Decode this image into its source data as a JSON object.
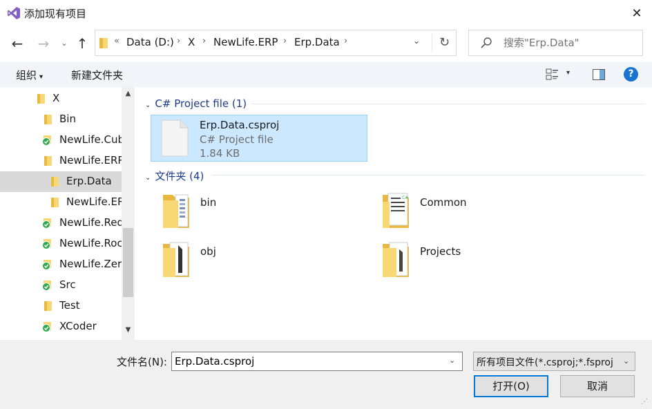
{
  "window": {
    "title": "添加现有项目",
    "close_glyph": "✕"
  },
  "nav": {
    "back_glyph": "←",
    "forward_glyph": "→",
    "recent_glyph": "⌄",
    "up_glyph": "↑",
    "refresh_glyph": "↻"
  },
  "address": {
    "overflow_glyph": "«",
    "separator": "›",
    "dropdown_glyph": "⌄",
    "crumbs": [
      "Data (D:)",
      "X",
      "NewLife.ERP",
      "Erp.Data"
    ]
  },
  "search": {
    "placeholder": "搜索\"Erp.Data\""
  },
  "toolbar": {
    "organize_label": "组织",
    "organize_caret": "▾",
    "new_folder_label": "新建文件夹",
    "view_caret": "▾",
    "help_label": "?"
  },
  "tree": {
    "items": [
      {
        "label": "X",
        "icon": "folder-icon"
      },
      {
        "label": "Bin",
        "icon": "folder-icon"
      },
      {
        "label": "NewLife.Cube",
        "icon": "folder-synced-icon"
      },
      {
        "label": "NewLife.ERP",
        "icon": "folder-icon"
      },
      {
        "label": "Erp.Data",
        "icon": "folder-icon",
        "selected": true
      },
      {
        "label": "NewLife.ERP.Web",
        "icon": "folder-icon"
      },
      {
        "label": "NewLife.Redis",
        "icon": "folder-synced-icon"
      },
      {
        "label": "NewLife.Roc",
        "icon": "folder-synced-icon"
      },
      {
        "label": "NewLife.Zero",
        "icon": "folder-synced-icon"
      },
      {
        "label": "Src",
        "icon": "folder-synced-icon"
      },
      {
        "label": "Test",
        "icon": "folder-icon"
      },
      {
        "label": "XCoder",
        "icon": "folder-synced-icon"
      }
    ],
    "scroll_up": "▲",
    "scroll_down": "▼"
  },
  "content": {
    "groups": [
      {
        "label": "C# Project file (1)",
        "caret": "⌄"
      },
      {
        "label": "文件夹 (4)",
        "caret": "⌄"
      }
    ],
    "file": {
      "name": "Erp.Data.csproj",
      "type": "C# Project file",
      "size": "1.84 KB"
    },
    "folders": [
      {
        "label": "bin",
        "icon": "folder-binary-icon"
      },
      {
        "label": "Common",
        "icon": "folder-csharp-icon"
      },
      {
        "label": "obj",
        "icon": "folder-file-icon"
      },
      {
        "label": "Projects",
        "icon": "folder-file-icon"
      }
    ]
  },
  "bottom": {
    "filename_label": "文件名(N):",
    "filename_value": "Erp.Data.csproj",
    "filename_dd": "⌄",
    "filter_value": "所有项目文件(*.csproj;*.fsproj",
    "filter_caret": "⌄",
    "open_label": "打开(O)",
    "cancel_label": "取消"
  },
  "colors": {
    "accent": "#0078d7",
    "selection_bg": "#cce8ff",
    "folder_yellow": "#f8d775",
    "vs_purple": "#865fc5",
    "sync_green": "#2fa84f"
  }
}
